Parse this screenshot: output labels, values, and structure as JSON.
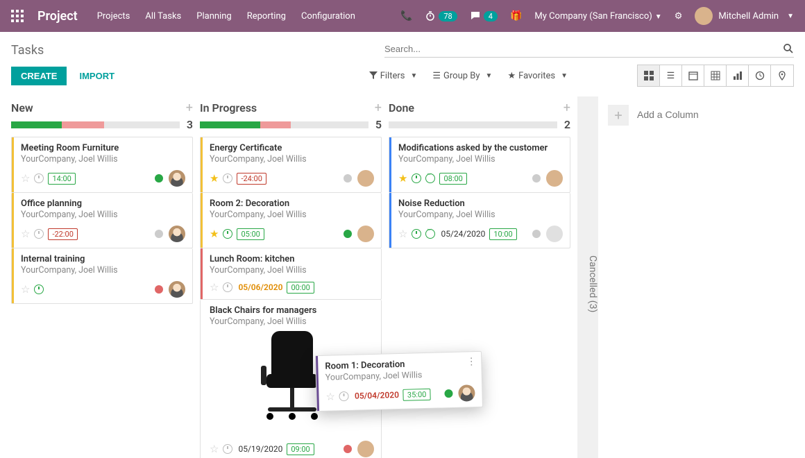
{
  "brand": "Project",
  "nav": {
    "projects": "Projects",
    "all_tasks": "All Tasks",
    "planning": "Planning",
    "reporting": "Reporting",
    "configuration": "Configuration"
  },
  "header": {
    "clock_badge": "78",
    "chat_badge": "4",
    "company": "My Company (San Francisco)",
    "user": "Mitchell Admin"
  },
  "breadcrumb": "Tasks",
  "actions": {
    "create": "CREATE",
    "import": "IMPORT"
  },
  "search": {
    "placeholder": "Search..."
  },
  "filters": {
    "filters": "Filters",
    "group_by": "Group By",
    "favorites": "Favorites"
  },
  "add_column": "Add a Column",
  "collapsed_column": "Cancelled (3)",
  "columns": {
    "new": {
      "title": "New",
      "count": "3",
      "green_pct": 30,
      "red_pct": 25,
      "cards": [
        {
          "title": "Meeting Room Furniture",
          "sub": "YourCompany, Joel Willis",
          "star": false,
          "clock": "grey",
          "chip": "14:00",
          "chip_neg": false,
          "dot": "green"
        },
        {
          "title": "Office planning",
          "sub": "YourCompany, Joel Willis",
          "star": false,
          "clock": "grey",
          "chip": "-22:00",
          "chip_neg": true,
          "dot": "grey"
        },
        {
          "title": "Internal training",
          "sub": "YourCompany, Joel Willis",
          "star": false,
          "clock": "green",
          "dot": "red"
        }
      ]
    },
    "in_progress": {
      "title": "In Progress",
      "count": "5",
      "green_pct": 36,
      "red_pct": 18,
      "cards": [
        {
          "title": "Energy Certificate",
          "sub": "YourCompany, Joel Willis",
          "star": true,
          "clock": "grey",
          "chip": "-24:00",
          "chip_neg": true,
          "dot": "grey"
        },
        {
          "title": "Room 2: Decoration",
          "sub": "YourCompany, Joel Willis",
          "star": true,
          "clock": "green",
          "chip": "05:00",
          "chip_neg": false,
          "dot": "green"
        },
        {
          "title": "Lunch Room: kitchen",
          "sub": "YourCompany, Joel Willis",
          "star": false,
          "clock": "grey",
          "date": "05/06/2020",
          "date_color": "orange",
          "chip": "00:00",
          "chip_neg": false
        },
        {
          "title": "Black Chairs for managers",
          "sub": "YourCompany, Joel Willis",
          "star": false,
          "clock": "grey",
          "date": "05/19/2020",
          "date_color": "",
          "chip": "09:00",
          "chip_neg": false,
          "dot": "red",
          "chair": true
        }
      ]
    },
    "done": {
      "title": "Done",
      "count": "2",
      "green_pct": 0,
      "red_pct": 0,
      "cards": [
        {
          "title": "Modifications asked by the customer",
          "sub": "YourCompany, Joel Willis",
          "star": true,
          "clock": "green",
          "smiley": true,
          "chip": "08:00",
          "chip_neg": false,
          "dot": "grey"
        },
        {
          "title": "Noise Reduction",
          "sub": "YourCompany, Joel Willis",
          "star": false,
          "clock": "green",
          "smiley": true,
          "date": "05/24/2020",
          "date_color": "",
          "chip": "10:00",
          "chip_neg": false,
          "dot": "grey"
        }
      ]
    }
  },
  "dragged": {
    "title": "Room 1: Decoration",
    "sub": "YourCompany, Joel Willis",
    "date": "05/04/2020",
    "chip": "35:00",
    "dot": "green"
  }
}
